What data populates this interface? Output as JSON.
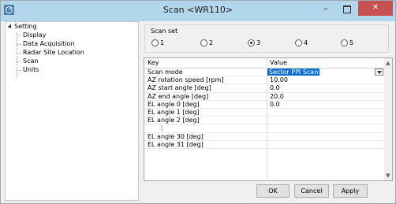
{
  "window": {
    "title": "Scan <WR110>",
    "minimize_glyph": "–",
    "close_glyph": "✕"
  },
  "tree": {
    "root": "Setting",
    "children": [
      "Display",
      "Data Acquisition",
      "Radar Site Location",
      "Scan",
      "Units"
    ]
  },
  "scan_set": {
    "label": "Scan set",
    "options": [
      "1",
      "2",
      "3",
      "4",
      "5"
    ],
    "selected": "3"
  },
  "grid": {
    "headers": {
      "key": "Key",
      "value": "Value"
    },
    "rows": [
      {
        "key": "Scan mode",
        "value": "Sector PPI Scan"
      },
      {
        "key": "AZ rotation speed [rpm]",
        "value": "10.00"
      },
      {
        "key": "AZ start angle [deg]",
        "value": "0.0"
      },
      {
        "key": "AZ end angle [deg]",
        "value": "20.0"
      },
      {
        "key": "EL angle 0 [deg]",
        "value": "0.0"
      },
      {
        "key": "EL angle 1 [deg]",
        "value": ""
      },
      {
        "key": "EL angle 2 [deg]",
        "value": ""
      },
      {
        "key": "⋮",
        "value": ""
      },
      {
        "key": "EL angle 30 [deg]",
        "value": ""
      },
      {
        "key": "EL angle 31 [deg]",
        "value": ""
      }
    ]
  },
  "buttons": {
    "ok": "OK",
    "cancel": "Cancel",
    "apply": "Apply"
  },
  "colors": {
    "titlebar": "#b2d7ec",
    "close": "#c75050",
    "selection": "#0b6fd1"
  }
}
